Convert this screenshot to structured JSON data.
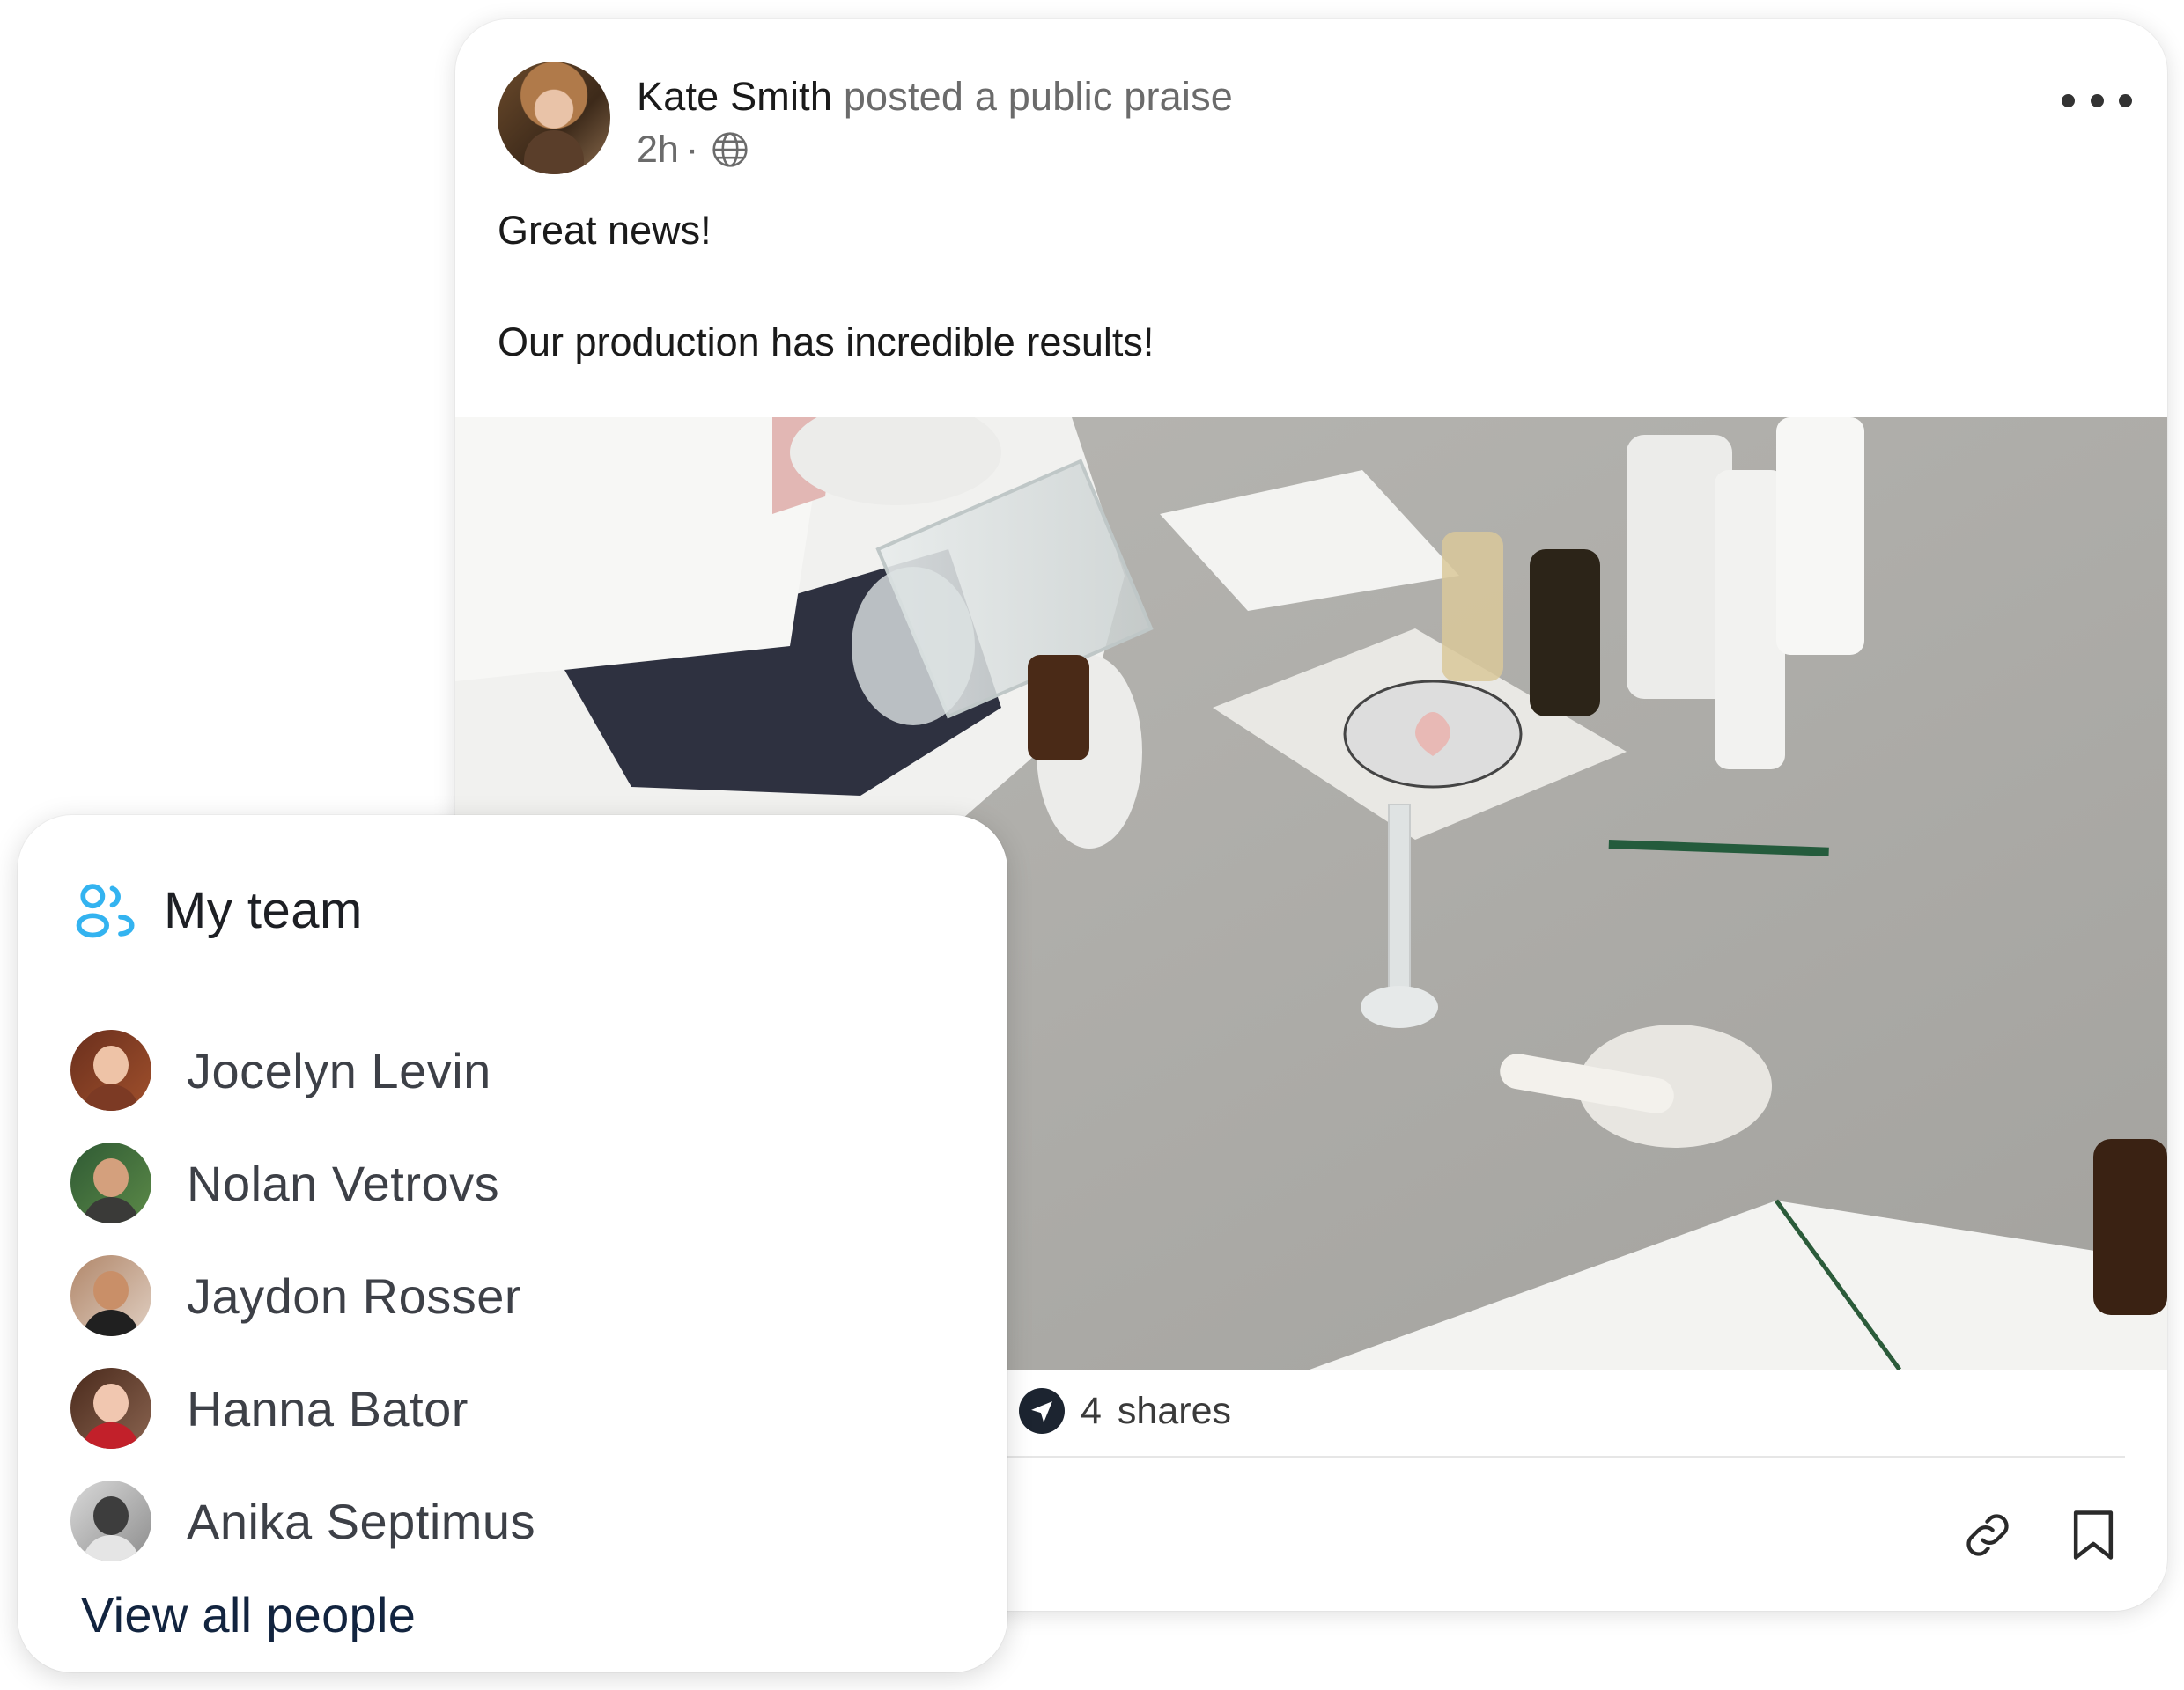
{
  "post": {
    "author": "Kate Smith",
    "action": "posted a public praise",
    "time": "2h",
    "separator": "·",
    "visibility_icon": "globe-icon",
    "more_icon": "more-horizontal-icon",
    "body": [
      "Great news!",
      "Our production has incredible results!"
    ],
    "shares_count": "4",
    "shares_label": "shares",
    "share_icon": "send-icon",
    "actions": [
      {
        "icon": "link-icon"
      },
      {
        "icon": "bookmark-icon"
      }
    ]
  },
  "team": {
    "icon": "team-icon",
    "title": "My team",
    "members": [
      {
        "name": "Jocelyn Levin"
      },
      {
        "name": "Nolan Vetrovs"
      },
      {
        "name": "Jaydon Rosser"
      },
      {
        "name": "Hanna Bator"
      },
      {
        "name": "Anika Septimus"
      }
    ],
    "view_all": "View all people"
  },
  "colors": {
    "accent": "#33b3f0",
    "text_dark": "#1a1a1a",
    "text_muted": "#6b6b6b",
    "link_dark": "#12243f"
  }
}
